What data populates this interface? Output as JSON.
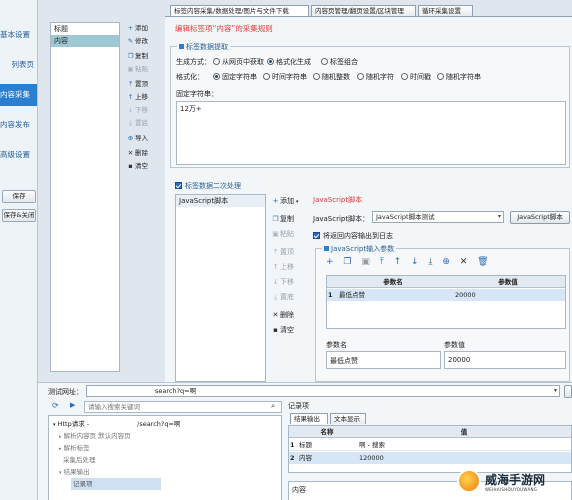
{
  "left_nav": {
    "items": [
      {
        "label": "基本设置",
        "active": false
      },
      {
        "label": "列表页",
        "active": false
      },
      {
        "label": "内容采集",
        "active": true
      },
      {
        "label": "内容发布",
        "active": false
      },
      {
        "label": "高级设置",
        "active": false
      }
    ],
    "save_label": "保存",
    "save_close_label": "保存&关闭"
  },
  "labels": {
    "items": [
      {
        "label": "标题",
        "selected": false
      },
      {
        "label": "内容",
        "selected": true
      }
    ],
    "toolbar": [
      {
        "label": "添加",
        "icon": "plus-icon",
        "enabled": true
      },
      {
        "label": "修改",
        "icon": "edit-icon",
        "enabled": true
      },
      {
        "label": "复制",
        "icon": "copy-icon",
        "enabled": true
      },
      {
        "label": "粘贴",
        "icon": "paste-icon",
        "enabled": false
      },
      {
        "label": "置顶",
        "icon": "top-icon",
        "enabled": true
      },
      {
        "label": "上移",
        "icon": "up-icon",
        "enabled": true
      },
      {
        "label": "下移",
        "icon": "down-icon",
        "enabled": false
      },
      {
        "label": "置底",
        "icon": "bottom-icon",
        "enabled": false
      },
      {
        "label": "导入",
        "icon": "import-icon",
        "enabled": true
      },
      {
        "label": "删除",
        "icon": "delete-icon",
        "enabled": true
      },
      {
        "label": "清空",
        "icon": "clear-icon",
        "enabled": true
      }
    ]
  },
  "tabs": [
    {
      "label": "标签内容采集/数据处理/图片与文件下载",
      "active": true
    },
    {
      "label": "内容页管理/翻页设置/区块管理",
      "active": false
    },
    {
      "label": "循环采集设置",
      "active": false
    }
  ],
  "editing_title": "编辑标签项“内容”的采集规则",
  "extract": {
    "title": "标签数据提取",
    "gen_label": "生成方式：",
    "gen_options": [
      {
        "label": "从网页中获取",
        "checked": false
      },
      {
        "label": "格式化生成",
        "checked": true
      },
      {
        "label": "标签组合",
        "checked": false
      }
    ],
    "format_label": "格式化：",
    "format_options": [
      {
        "label": "固定字符串",
        "checked": true
      },
      {
        "label": "时间字符串",
        "checked": false
      },
      {
        "label": "随机整数",
        "checked": false
      },
      {
        "label": "随机字符",
        "checked": false
      },
      {
        "label": "时间戳",
        "checked": false
      },
      {
        "label": "随机字符串",
        "checked": false
      }
    ],
    "fixed_label": "固定字符串：",
    "fixed_value": "12万+"
  },
  "secondary": {
    "title": "标签数据二次处理",
    "list_items": [
      "JavaScript脚本"
    ],
    "toolbar": [
      {
        "label": "添加",
        "icon": "plus-icon",
        "enabled": true
      },
      {
        "label": "复制",
        "icon": "copy-icon",
        "enabled": true
      },
      {
        "label": "粘贴",
        "icon": "paste-icon",
        "enabled": false
      },
      {
        "label": "置顶",
        "icon": "top-icon",
        "enabled": false
      },
      {
        "label": "上移",
        "icon": "up-icon",
        "enabled": false
      },
      {
        "label": "下移",
        "icon": "down-icon",
        "enabled": false
      },
      {
        "label": "置底",
        "icon": "bottom-icon",
        "enabled": false
      },
      {
        "label": "删除",
        "icon": "delete-icon",
        "enabled": true
      },
      {
        "label": "清空",
        "icon": "clear-icon",
        "enabled": true
      }
    ],
    "js_title": "JavaScript脚本",
    "js_label": "JavaScript脚本：",
    "js_select_value": "JavaScript脚本测试",
    "js_button": "JavaScript脚本",
    "output_log_label": "将返回内容输出到日志",
    "params_title": "JavaScript输入参数",
    "params_headers": [
      "参数名",
      "参数值"
    ],
    "params_rows": [
      {
        "index": "1",
        "name": "最低点赞",
        "value": "20000"
      }
    ],
    "param_name_label": "参数名",
    "param_value_label": "参数值",
    "param_name_value": "最低点赞",
    "param_value_value": "20000"
  },
  "bottom": {
    "test_url_label": "测试网址：",
    "test_url_value": "search?q=啊",
    "search_placeholder": "请输入搜索关键词",
    "tree": [
      {
        "label": "Http请求 -",
        "suffix": "/search?q=啊",
        "indent": 0,
        "dark": true
      },
      {
        "label": "解析内容页 默认内容页",
        "suffix": "",
        "indent": 1,
        "dark": false
      },
      {
        "label": "解析标签",
        "suffix": "",
        "indent": 1,
        "dark": false
      },
      {
        "label": "采集后处理",
        "suffix": "",
        "indent": 1,
        "dark": false
      },
      {
        "label": "结果输出",
        "suffix": "",
        "indent": 1,
        "dark": false
      },
      {
        "label": "记录项",
        "suffix": "",
        "indent": 2,
        "dark": false
      }
    ],
    "record_title": "记录项",
    "result_tabs": [
      "结果输出",
      "文本显示"
    ],
    "result_headers": [
      "名称",
      "值"
    ],
    "result_rows": [
      {
        "index": "1",
        "name": "标题",
        "value": "啊 - 搜索"
      },
      {
        "index": "2",
        "name": "内容",
        "value": "120000"
      }
    ],
    "content_label": "内容"
  },
  "watermark": {
    "text": "威海手游网",
    "sub": "WEIHAISHOUYOUWANG"
  },
  "colors": {
    "accent": "#2b7fd1",
    "title_red": "#e53935",
    "selected_row": "#9ec8d4"
  }
}
